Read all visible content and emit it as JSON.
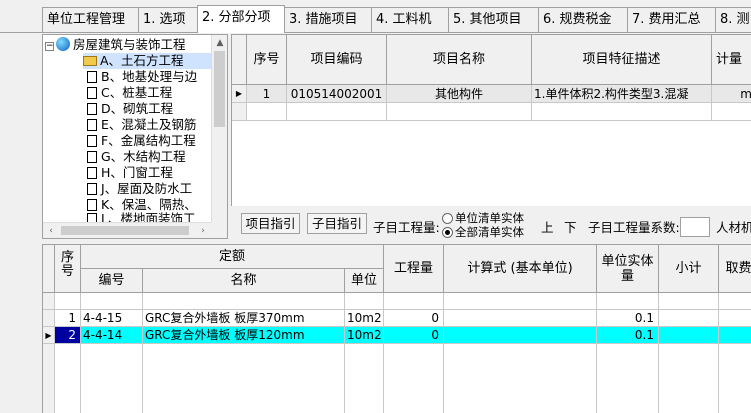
{
  "tabs": [
    {
      "label": "单位工程管理"
    },
    {
      "label": "1. 选项"
    },
    {
      "label": "2. 分部分项"
    },
    {
      "label": "3. 措施项目"
    },
    {
      "label": "4. 工料机"
    },
    {
      "label": "5. 其他项目"
    },
    {
      "label": "6. 规费税金"
    },
    {
      "label": "7. 费用汇总"
    },
    {
      "label": "8. 测"
    }
  ],
  "tree": {
    "root": "房屋建筑与装饰工程",
    "items": [
      "A、土石方工程",
      "B、地基处理与边",
      "C、桩基工程",
      "D、砌筑工程",
      "E、混凝土及钢筋",
      "F、金属结构工程",
      "G、木结构工程",
      "H、门窗工程",
      "J、屋面及防水工",
      "K、保温、隔热、",
      "L、楼地面装饰工"
    ]
  },
  "upper_table": {
    "headers": [
      "序号",
      "项目编码",
      "项目名称",
      "项目特征描述",
      "计量"
    ],
    "rows": [
      [
        "1",
        "010514002001",
        "其他构件",
        "1.单件体积2.构件类型3.混凝",
        "m"
      ]
    ]
  },
  "midbar": {
    "btn_item_guide": "项目指引",
    "btn_sub_guide": "子目指引",
    "sub_qty_label": "子目工程量:",
    "radio_unit": "单位清单实体",
    "radio_all": "全部清单实体",
    "up": "上",
    "down": "下",
    "coef_label": "子目工程量系数:",
    "labor_label": "人材机"
  },
  "lower_table": {
    "headers": {
      "seq": "序号",
      "quota_group": "定额",
      "code": "编号",
      "name": "名称",
      "unit": "单位",
      "quantity": "工程量",
      "formula": "计算式 (基本单位)",
      "unit_entity": "单位实体量",
      "subtotal": "小计",
      "take": "取费"
    },
    "rows": [
      {
        "seq": "1",
        "code": "4-4-15",
        "name": "GRC复合外墙板 板厚370mm",
        "unit": "10m2",
        "qty": "0",
        "formula": "",
        "unit_entity": "0.1",
        "subtotal": "",
        "take": ""
      },
      {
        "seq": "2",
        "code": "4-4-14",
        "name": "GRC复合外墙板 板厚120mm",
        "unit": "10m2",
        "qty": "0",
        "formula": "",
        "unit_entity": "0.1",
        "subtotal": "",
        "take": ""
      }
    ]
  },
  "colors": {
    "highlight": "#00ffff",
    "selected_row": "#0000a0"
  }
}
